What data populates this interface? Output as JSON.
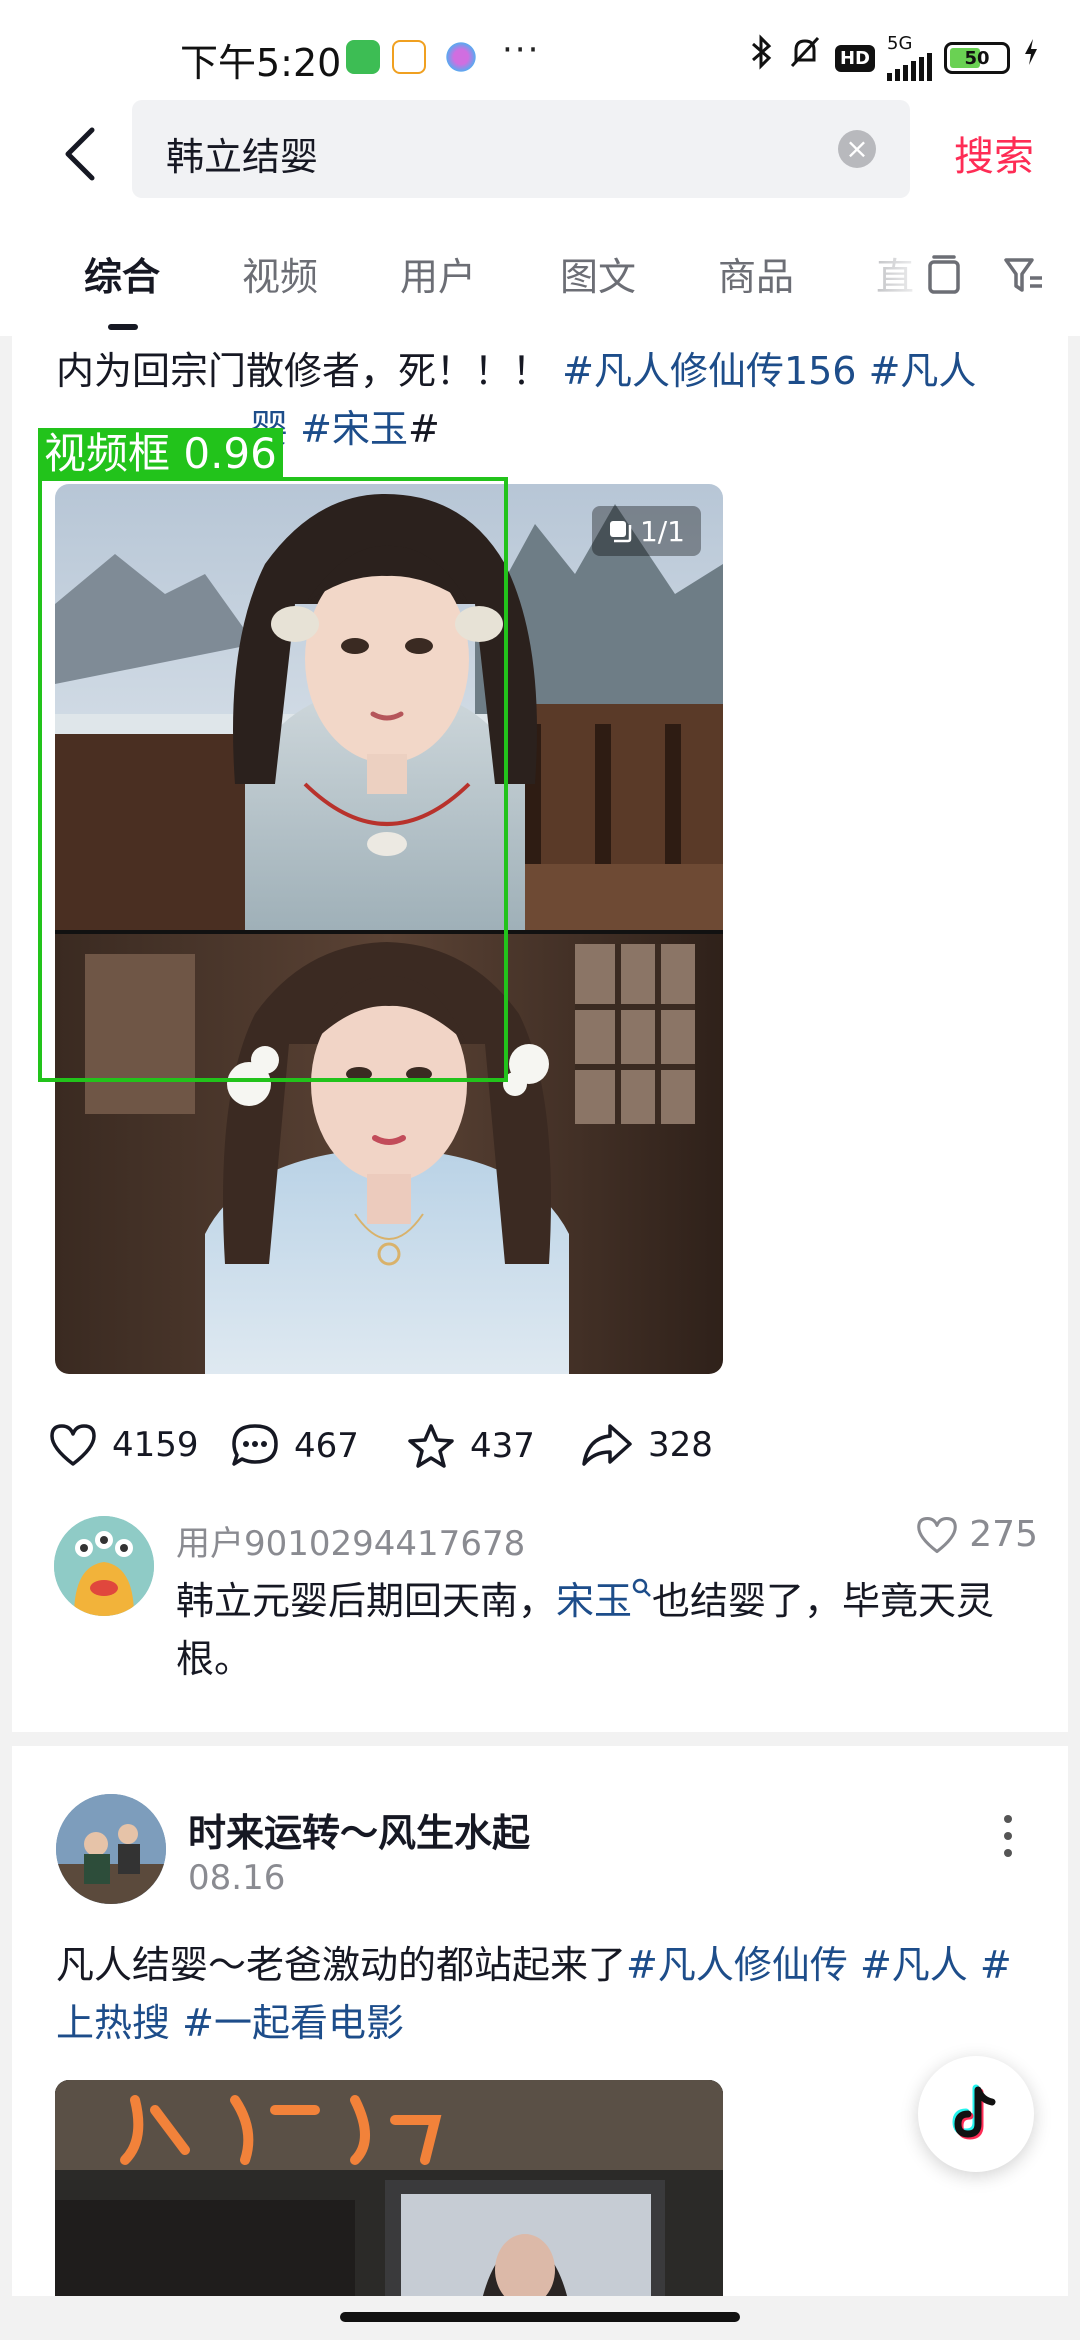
{
  "status_bar": {
    "time": "下午5:20",
    "network": "5G",
    "hd_badge": "HD",
    "battery_level": "50",
    "icons": [
      "wechat-app-icon",
      "58-app-icon",
      "flower-app-icon",
      "more-dots-icon",
      "bluetooth-icon",
      "mute-bell-icon",
      "signal-icon",
      "battery-icon",
      "charging-icon"
    ]
  },
  "search": {
    "query": "韩立结婴",
    "submit_label": "搜索"
  },
  "tabs": {
    "items": [
      "综合",
      "视频",
      "用户",
      "图文",
      "商品",
      "直"
    ],
    "active": "综合"
  },
  "post1": {
    "text_line1": "内为回宗门散修者，死！！！",
    "tag1": "#凡人修仙传156",
    "tag2": "#凡人",
    "text_line2_end": "婴",
    "tag3": "#宋玉",
    "trailing_hash": "#",
    "image_count": "1/1",
    "detection_label": "视频框 0.96",
    "likes": "4159",
    "comments": "467",
    "favorites": "437",
    "shares": "328",
    "comment": {
      "user": "用户9010294417678",
      "likes": "275",
      "text_before": "韩立元婴后期回天南，",
      "link": "宋玉",
      "text_after": "也结婴了，毕竟天灵根。"
    }
  },
  "post2": {
    "author": "时来运转～风生水起",
    "date": "08.16",
    "text": "凡人结婴～老爸激动的都站起来了",
    "tag1": "#凡人修仙传",
    "tag2": "#凡人",
    "tag3": "#上热搜",
    "tag4": "#一起看电影"
  },
  "colors": {
    "accent": "#fe2c55",
    "tag_blue": "#1d4d8a",
    "detection_green": "#22c31b"
  }
}
